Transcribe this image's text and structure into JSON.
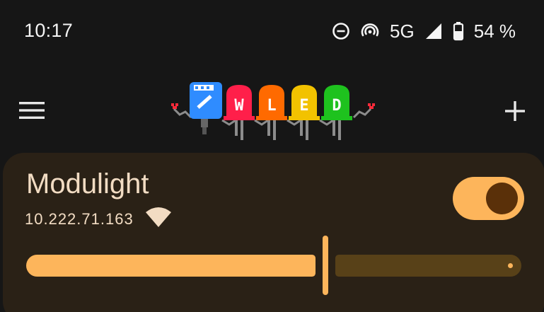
{
  "status_bar": {
    "time": "10:17",
    "network": "5G",
    "battery": "54 %",
    "icons": [
      "do-not-disturb-icon",
      "hotspot-icon",
      "signal-icon",
      "battery-icon"
    ]
  },
  "app_bar": {
    "menu_icon": "hamburger-menu-icon",
    "logo": "wled-logo",
    "logo_letters": [
      "W",
      "L",
      "E",
      "D"
    ],
    "add_icon": "plus-icon"
  },
  "device": {
    "name": "Modulight",
    "ip": "10.222.71.163",
    "wifi_icon": "wifi-signal-icon",
    "power_on": true,
    "brightness": 0.65
  },
  "colors": {
    "background": "#161616",
    "card": "#2a2116",
    "accent": "#fdb55b",
    "accent_dark": "#584118",
    "thumb": "#5a3009",
    "text": "#f2dcc3"
  }
}
